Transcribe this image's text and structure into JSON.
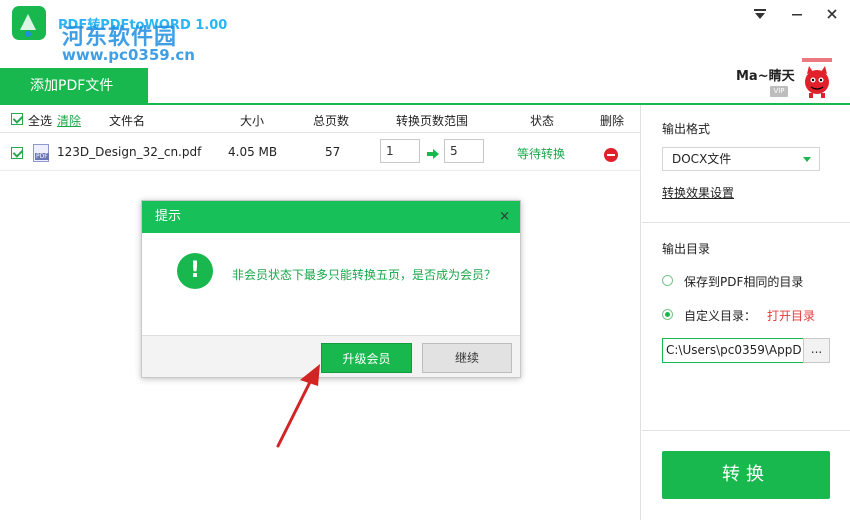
{
  "app": {
    "title": "PDF转PDFtoWORD 1.00",
    "watermark": "河东软件园",
    "watermark_url": "www.pc0359.cn",
    "window_controls": [
      "menu-icon",
      "minimize-icon",
      "close-icon"
    ]
  },
  "user": {
    "name": "Ma~睛天",
    "vip": "VIP"
  },
  "toolbar": {
    "add_pdf": "添加PDF文件"
  },
  "table": {
    "select_all": "全选",
    "clear": "清除",
    "columns": [
      "文件名",
      "大小",
      "总页数",
      "转换页数范围",
      "状态",
      "删除"
    ],
    "rows": [
      {
        "filename": "123D_Design_32_cn.pdf",
        "size": "4.05 MB",
        "pages": "57",
        "from": "1",
        "to": "5",
        "status": "等待转换"
      }
    ]
  },
  "sidebar": {
    "output_format_label": "输出格式",
    "format_selected": "DOCX文件",
    "effect_settings": "转换效果设置",
    "output_dir_label": "输出目录",
    "option_same": "保存到PDF相同的目录",
    "option_custom": "自定义目录：",
    "open_dir": "打开目录",
    "path": "C:\\Users\\pc0359\\AppD",
    "browse": "...",
    "convert": "转换"
  },
  "dialog": {
    "title": "提示",
    "close": "×",
    "icon": "!",
    "message": "非会员状态下最多只能转换五页，是否成为会员？",
    "upgrade": "升级会员",
    "continue": "继续"
  },
  "colors": {
    "accent": "#18b84e",
    "dialog_header": "#18c05a",
    "danger": "#e0202a",
    "arrow": "#d32424"
  }
}
